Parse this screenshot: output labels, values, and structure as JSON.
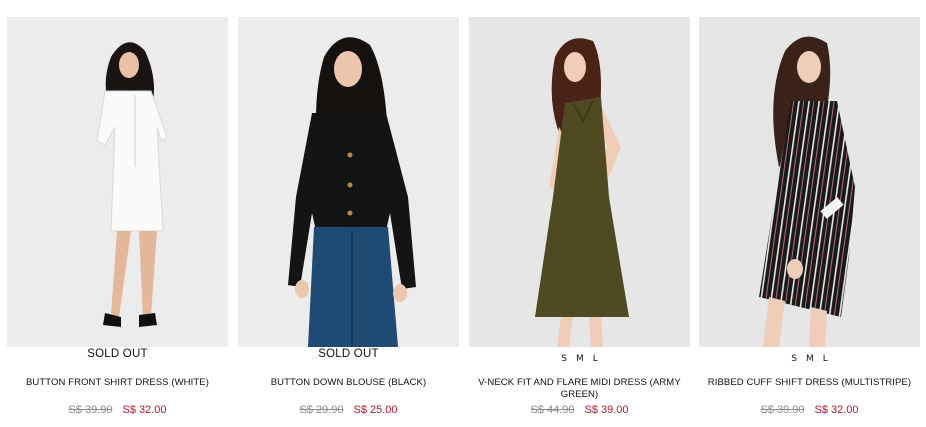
{
  "products": [
    {
      "image_alt": "Model wearing white button front shirt dress",
      "status": "SOLD OUT",
      "sizes": [],
      "name": "BUTTON FRONT SHIRT DRESS (WHITE)",
      "old_price": "S$ 39.90",
      "new_price": "S$ 32.00"
    },
    {
      "image_alt": "Model wearing black button down blouse and jeans",
      "status": "SOLD OUT",
      "sizes": [],
      "name": "BUTTON DOWN BLOUSE (BLACK)",
      "old_price": "S$ 29.90",
      "new_price": "S$ 25.00"
    },
    {
      "image_alt": "Model wearing army green v-neck midi dress",
      "status": "",
      "sizes": [
        "S",
        "M",
        "L"
      ],
      "name": "V-NECK FIT AND FLARE MIDI DRESS (ARMY GREEN)",
      "old_price": "S$ 44.90",
      "new_price": "S$ 39.00"
    },
    {
      "image_alt": "Model wearing multistripe ribbed cuff shift dress",
      "status": "",
      "sizes": [
        "S",
        "M",
        "L"
      ],
      "name": "RIBBED CUFF SHIFT DRESS (MULTISTRIPE)",
      "old_price": "S$ 39.90",
      "new_price": "S$ 32.00"
    }
  ],
  "colors": {
    "sale_price": "#b5172e",
    "old_price": "#8a8a8a",
    "photo_bg": "#ebebeb"
  }
}
